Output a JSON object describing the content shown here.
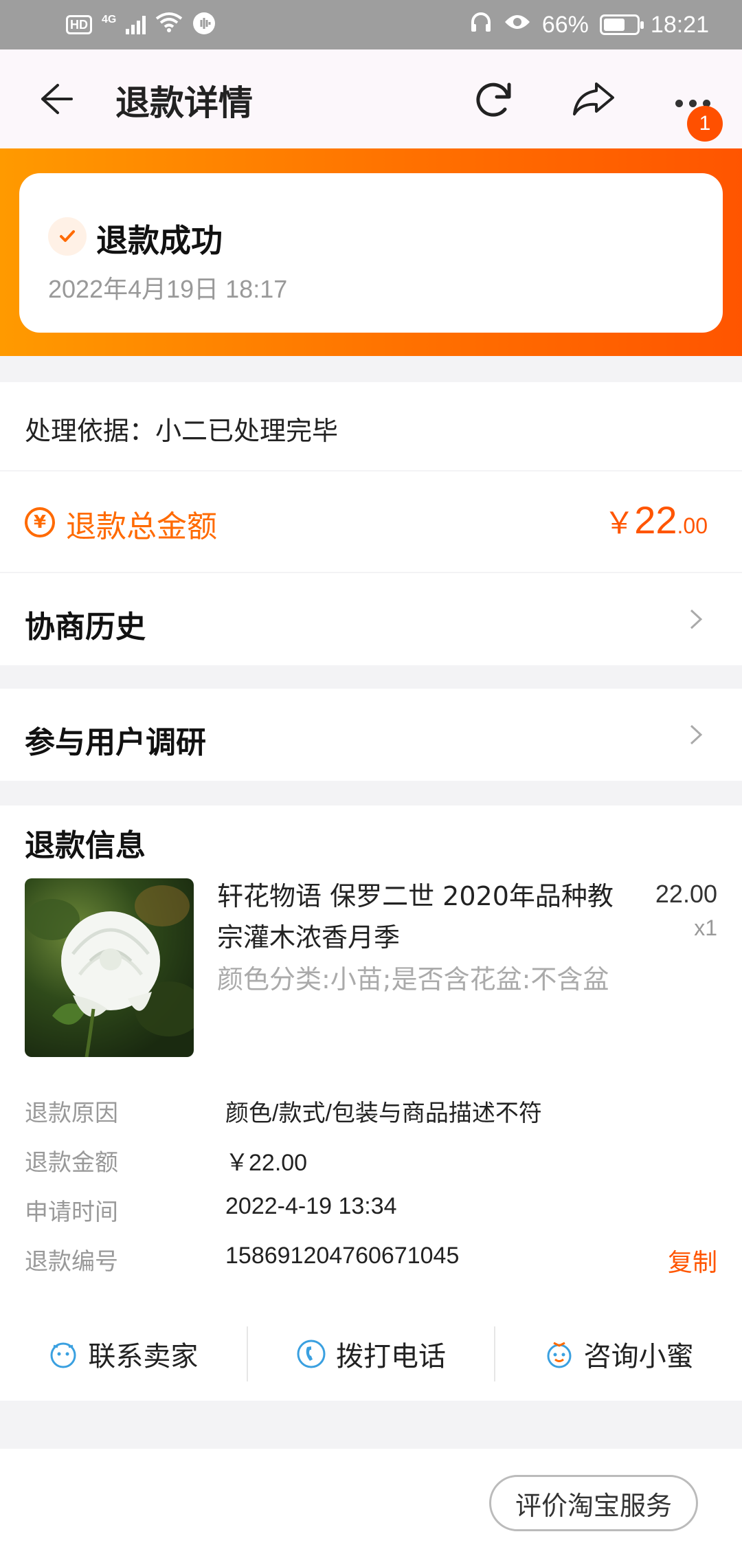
{
  "status_bar": {
    "hd": "HD",
    "network": "4G",
    "battery_percent": "66%",
    "battery_level": 0.66,
    "time": "18:21"
  },
  "header": {
    "title": "退款详情",
    "notification_count": "1",
    "icons": [
      "back-arrow-icon",
      "refresh-icon",
      "share-icon",
      "more-icon"
    ]
  },
  "refund_status": {
    "title": "退款成功",
    "time": "2022年4月19日 18:17"
  },
  "basis": {
    "text": "处理依据：小二已处理完毕"
  },
  "total": {
    "label": "退款总金额",
    "currency": "￥",
    "amount_int": "22",
    "amount_dec": ".00"
  },
  "links": {
    "history": "协商历史",
    "survey": "参与用户调研"
  },
  "refund_info": {
    "title": "退款信息",
    "product": {
      "name": "轩花物语 保罗二世 2020年品种教宗灌木浓香月季",
      "spec": "颜色分类:小苗;是否含花盆:不含盆",
      "price": "22.00",
      "qty": "x1"
    },
    "fields": [
      {
        "label": "退款原因",
        "value": "颜色/款式/包装与商品描述不符"
      },
      {
        "label": "退款金额",
        "value": "￥22.00"
      },
      {
        "label": "申请时间",
        "value": "2022-4-19 13:34"
      },
      {
        "label": "退款编号",
        "value": "158691204760671045"
      }
    ],
    "copy_label": "复制"
  },
  "actions": [
    {
      "label": "联系卖家",
      "icon": "chat-face-icon"
    },
    {
      "label": "拨打电话",
      "icon": "phone-icon"
    },
    {
      "label": "咨询小蜜",
      "icon": "assistant-icon"
    }
  ],
  "bottom": {
    "evaluate_label": "评价淘宝服务"
  },
  "colors": {
    "accent": "#ff5500",
    "banner_start": "#ff9a00",
    "banner_end": "#ff5500",
    "action_icon": "#3aa0e0"
  }
}
